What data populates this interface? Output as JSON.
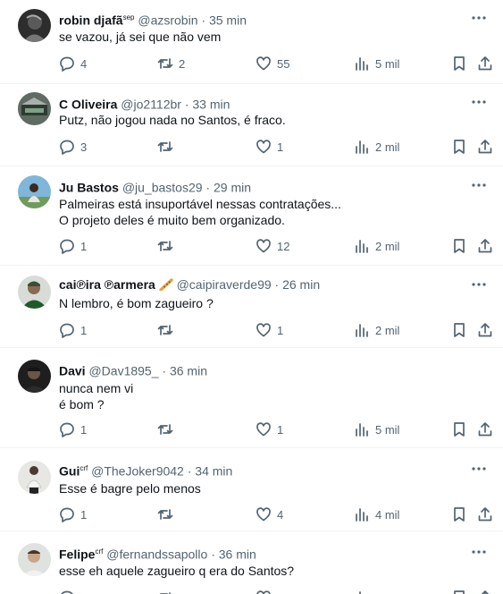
{
  "colors": {
    "text": "#0f1419",
    "muted": "#536471",
    "divider": "#eff3f4",
    "background": "#ffffff"
  },
  "icons": [
    "reply-icon",
    "retweet-icon",
    "like-icon",
    "views-icon",
    "bookmark-icon",
    "share-icon",
    "more-icon"
  ],
  "tweets": [
    {
      "name": "robin djafã",
      "badge": "sep",
      "handle": "@azsrobin",
      "dot": "·",
      "time": "35 min",
      "lines": [
        "se vazou, já sei que não vem"
      ],
      "replies": "4",
      "retweets": "2",
      "likes": "55",
      "views": "5 mil"
    },
    {
      "name": "C Oliveira",
      "badge": "",
      "handle": "@jo2112br",
      "dot": "·",
      "time": "33 min",
      "lines": [
        "Putz, não jogou nada no Santos, é fraco."
      ],
      "replies": "3",
      "retweets": "",
      "likes": "1",
      "views": "2 mil"
    },
    {
      "name": "Ju Bastos",
      "badge": "",
      "handle": "@ju_bastos29",
      "dot": "·",
      "time": "29 min",
      "lines": [
        "Palmeiras está insuportável nessas contratações...",
        "O projeto deles é muito bem organizado."
      ],
      "replies": "1",
      "retweets": "",
      "likes": "12",
      "views": "2 mil"
    },
    {
      "name": "cai℗ira ℗armera",
      "badge": "",
      "emoji": "flute-emoji",
      "handle": "@caipiraverde99",
      "dot": "·",
      "time": "26 min",
      "lines": [
        "N lembro, é bom zagueiro ?"
      ],
      "replies": "1",
      "retweets": "",
      "likes": "1",
      "views": "2 mil"
    },
    {
      "name": "Davi",
      "badge": "",
      "handle": "@Dav1895_",
      "dot": "·",
      "time": "36 min",
      "lines": [
        "nunca nem vi",
        "é bom ?"
      ],
      "replies": "1",
      "retweets": "",
      "likes": "1",
      "views": "5 mil"
    },
    {
      "name": "Gui",
      "badge": "crf",
      "handle": "@TheJoker9042",
      "dot": "·",
      "time": "34 min",
      "lines": [
        "Esse é bagre pelo menos"
      ],
      "replies": "1",
      "retweets": "",
      "likes": "4",
      "views": "4 mil"
    },
    {
      "name": "Felipe",
      "badge": "crf",
      "handle": "@fernandssapollo",
      "dot": "·",
      "time": "36 min",
      "lines": [
        "esse eh aquele zagueiro q era do Santos?"
      ],
      "replies": "",
      "retweets": "",
      "likes": "",
      "views": ""
    }
  ]
}
